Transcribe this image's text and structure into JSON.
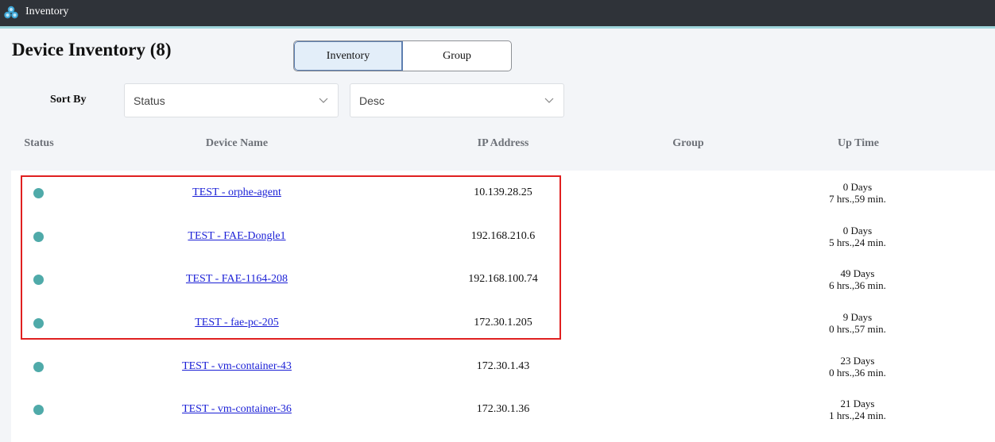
{
  "app": {
    "title": "Inventory",
    "logo_icon": "app-logo-icon"
  },
  "page": {
    "title": "Device Inventory (8)"
  },
  "tabs": [
    {
      "label": "Inventory",
      "active": true
    },
    {
      "label": "Group",
      "active": false
    }
  ],
  "sort": {
    "label": "Sort By",
    "field": "Status",
    "order": "Desc"
  },
  "table": {
    "columns": [
      "Status",
      "Device Name",
      "IP Address",
      "Group",
      "Up Time"
    ],
    "rows": [
      {
        "status": "online",
        "name": "TEST - orphe-agent",
        "ip": "10.139.28.25",
        "group": "",
        "uptime_days": "0 Days",
        "uptime_time": "7 hrs.,59 min."
      },
      {
        "status": "online",
        "name": "TEST - FAE-Dongle1",
        "ip": "192.168.210.6",
        "group": "",
        "uptime_days": "0 Days",
        "uptime_time": "5 hrs.,24 min."
      },
      {
        "status": "online",
        "name": "TEST - FAE-1164-208",
        "ip": "192.168.100.74",
        "group": "",
        "uptime_days": "49 Days",
        "uptime_time": "6 hrs.,36 min."
      },
      {
        "status": "online",
        "name": "TEST - fae-pc-205",
        "ip": "172.30.1.205",
        "group": "",
        "uptime_days": "9 Days",
        "uptime_time": "0 hrs.,57 min."
      },
      {
        "status": "online",
        "name": "TEST - vm-container-43",
        "ip": "172.30.1.43",
        "group": "",
        "uptime_days": "23 Days",
        "uptime_time": "0 hrs.,36 min."
      },
      {
        "status": "online",
        "name": "TEST - vm-container-36",
        "ip": "172.30.1.36",
        "group": "",
        "uptime_days": "21 Days",
        "uptime_time": "1 hrs.,24 min."
      }
    ]
  },
  "colors": {
    "status_online": "#4faaa9",
    "link": "#1a1fd6",
    "highlight": "#e02020",
    "topbar": "#2f3339"
  }
}
